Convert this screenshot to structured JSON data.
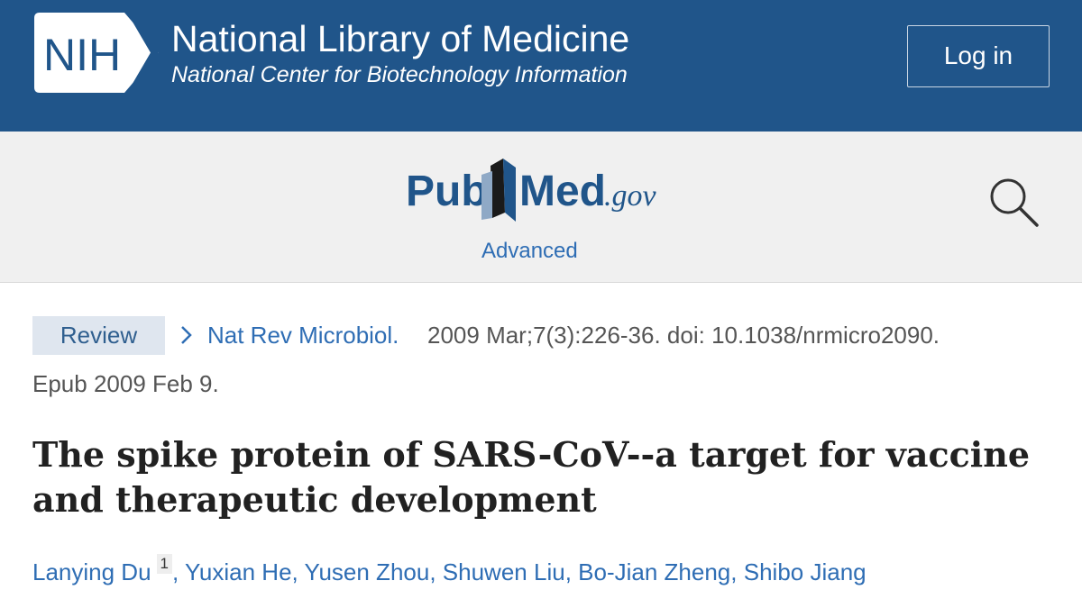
{
  "header": {
    "logo_text": "NIH",
    "title": "National Library of Medicine",
    "subtitle": "National Center for Biotechnology Information",
    "login_label": "Log in",
    "background_color": "#20558a"
  },
  "search_bar": {
    "logo_left": "Pub",
    "logo_right": "Med",
    "logo_suffix": ".gov",
    "advanced_label": "Advanced",
    "search_icon": "search-icon"
  },
  "article": {
    "type_badge": "Review",
    "journal": "Nat Rev Microbiol.",
    "citation": "2009 Mar;7(3):226-36. doi: 10.1038/nrmicro2090.",
    "epub": "Epub 2009 Feb 9.",
    "title": "The spike protein of SARS-CoV--a target for vaccine and therapeutic development",
    "authors": [
      {
        "name": "Lanying Du",
        "affiliation": "1"
      },
      {
        "name": "Yuxian He"
      },
      {
        "name": "Yusen Zhou"
      },
      {
        "name": "Shuwen Liu"
      },
      {
        "name": "Bo-Jian Zheng"
      },
      {
        "name": "Shibo Jiang"
      }
    ],
    "separator": ",",
    "link_color": "#2e6db4"
  }
}
